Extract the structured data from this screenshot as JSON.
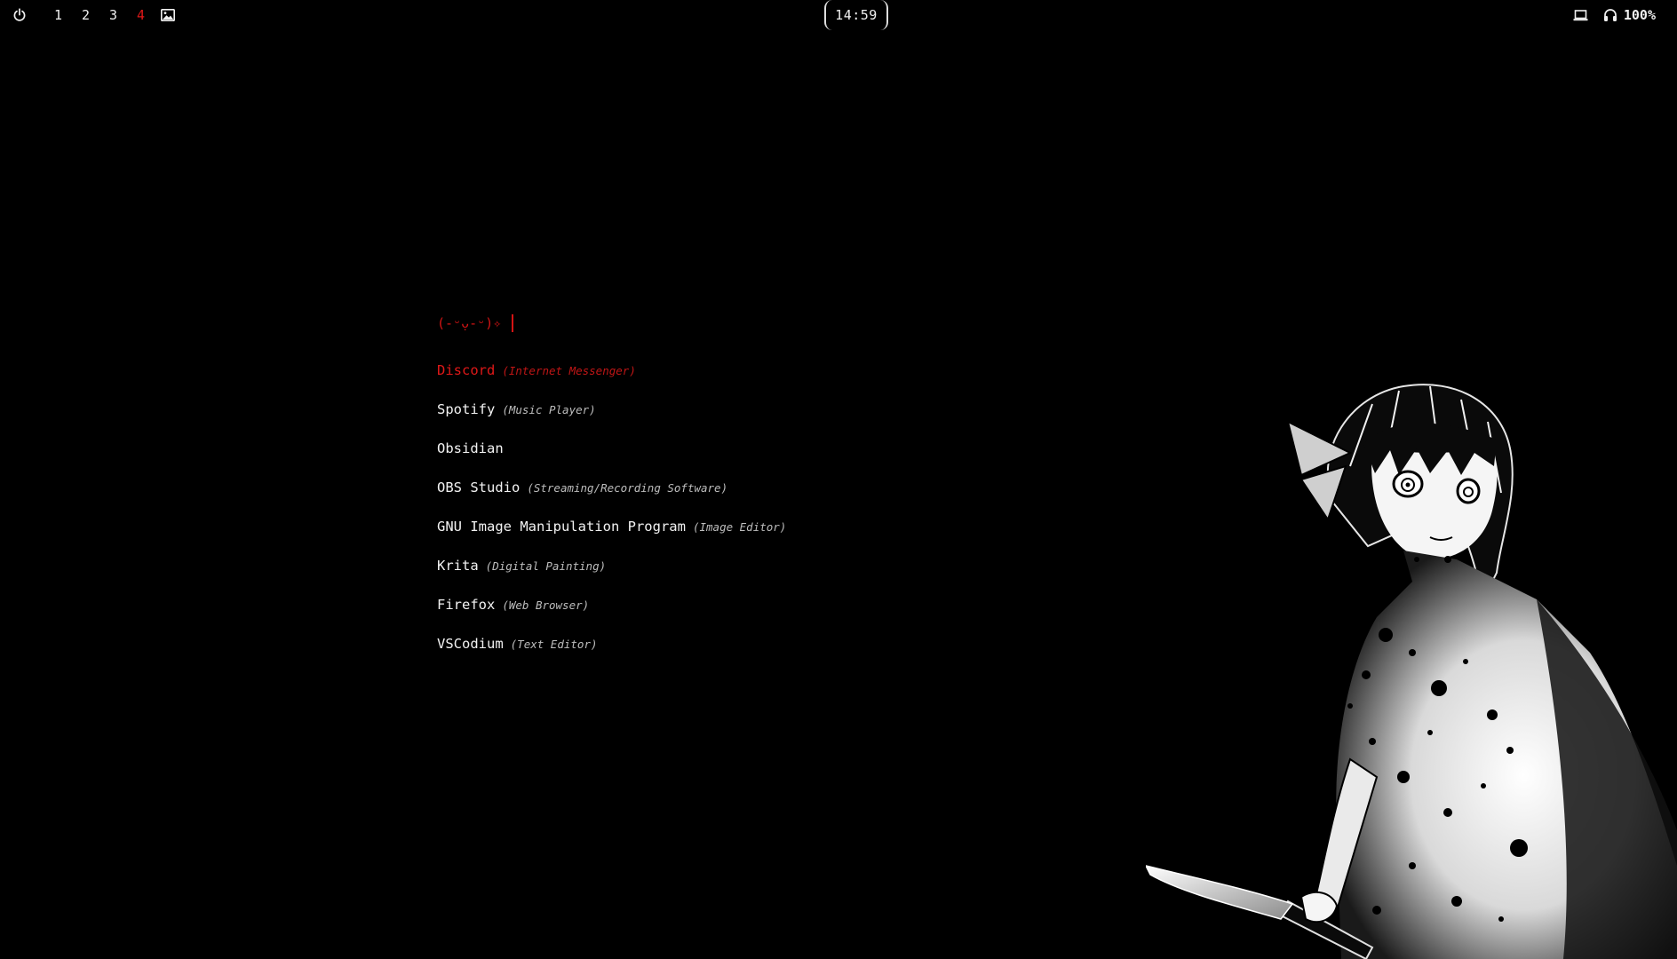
{
  "topbar": {
    "workspaces": [
      "1",
      "2",
      "3",
      "4"
    ],
    "active_workspace": "4",
    "clock": "14:59",
    "volume": "100%"
  },
  "icons": {
    "power": "power-icon",
    "wallpaper": "image-icon",
    "laptop": "laptop-icon",
    "headphones": "headphones-icon"
  },
  "colors": {
    "background": "#000000",
    "accent": "#d41414",
    "text": "#f2f2f2",
    "muted": "#bdbdbd"
  },
  "launcher": {
    "prompt": "(-ᵕ̣ᴗ-ᵕ)✧",
    "input_value": "",
    "selected_index": 0,
    "entries": [
      {
        "name": "Discord",
        "desc": "(Internet Messenger)"
      },
      {
        "name": "Spotify",
        "desc": "(Music Player)"
      },
      {
        "name": "Obsidian",
        "desc": ""
      },
      {
        "name": "OBS Studio",
        "desc": "(Streaming/Recording Software)"
      },
      {
        "name": "GNU Image Manipulation Program",
        "desc": "(Image Editor)"
      },
      {
        "name": "Krita",
        "desc": "(Digital Painting)"
      },
      {
        "name": "Firefox",
        "desc": "(Web Browser)"
      },
      {
        "name": "VSCodium",
        "desc": "(Text Editor)"
      }
    ]
  }
}
